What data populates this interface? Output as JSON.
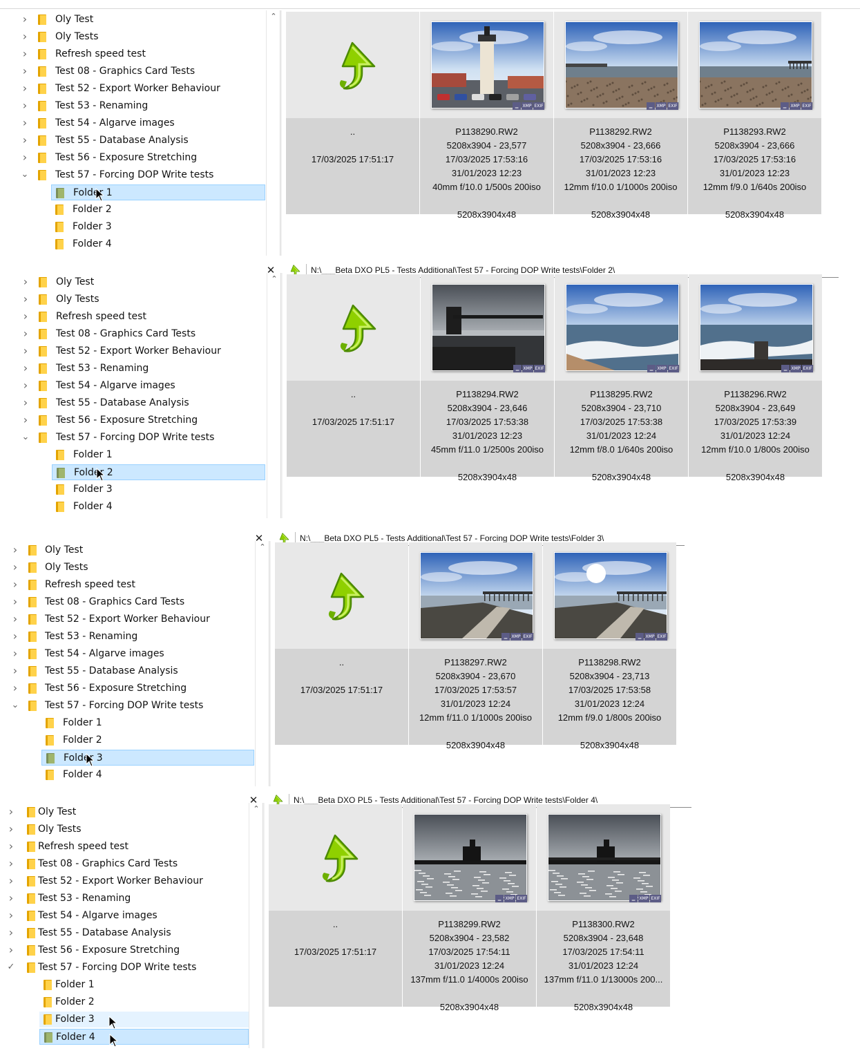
{
  "tree_items": [
    "Oly Test",
    "Oly Tests",
    "Refresh speed test",
    "Test 08 - Graphics Card Tests",
    "Test 52 - Export Worker Behaviour",
    "Test 53 - Renaming",
    "Test 54 - Algarve images",
    "Test 55 - Database Analysis",
    "Test 56 - Exposure Stretching",
    "Test 57 - Forcing DOP Write tests"
  ],
  "sub_items": [
    "Folder 1",
    "Folder 2",
    "Folder 3",
    "Folder 4"
  ],
  "parent_dir": {
    "label": "..",
    "date": "17/03/2025 17:51:17"
  },
  "badges": [
    "▁",
    "XMP",
    "EXIF"
  ],
  "panels": [
    {
      "path": "",
      "selected": 0,
      "files": [
        {
          "name": "P1138290.RW2",
          "dims": "5208x3904 - 23,577",
          "modified": "17/03/2025 17:53:16",
          "taken": "31/01/2023 12:23",
          "exposure": "40mm f/10.0 1/500s 200iso",
          "res": "5208x3904x48",
          "scene": "lighthouse"
        },
        {
          "name": "P1138292.RW2",
          "dims": "5208x3904 - 23,666",
          "modified": "17/03/2025 17:53:16",
          "taken": "31/01/2023 12:23",
          "exposure": "12mm f/10.0 1/1000s 200iso",
          "res": "5208x3904x48",
          "scene": "beach-sun"
        },
        {
          "name": "P1138293.RW2",
          "dims": "5208x3904 - 23,666",
          "modified": "17/03/2025 17:53:16",
          "taken": "31/01/2023 12:23",
          "exposure": "12mm f/9.0 1/640s 200iso",
          "res": "5208x3904x48",
          "scene": "beach-pier"
        }
      ]
    },
    {
      "path": "N:\\___Beta DXO PL5 - Tests Additional\\Test 57 - Forcing DOP Write tests\\Folder 2\\",
      "selected": 1,
      "files": [
        {
          "name": "P1138294.RW2",
          "dims": "5208x3904 - 23,646",
          "modified": "17/03/2025 17:53:38",
          "taken": "31/01/2023 12:23",
          "exposure": "45mm f/11.0 1/2500s 200iso",
          "res": "5208x3904x48",
          "scene": "harbour-dark"
        },
        {
          "name": "P1138295.RW2",
          "dims": "5208x3904 - 23,710",
          "modified": "17/03/2025 17:53:38",
          "taken": "31/01/2023 12:24",
          "exposure": "12mm f/8.0 1/640s 200iso",
          "res": "5208x3904x48",
          "scene": "beach-waves"
        },
        {
          "name": "P1138296.RW2",
          "dims": "5208x3904 - 23,649",
          "modified": "17/03/2025 17:53:39",
          "taken": "31/01/2023 12:24",
          "exposure": "12mm f/10.0 1/800s 200iso",
          "res": "5208x3904x48",
          "scene": "waves-post"
        }
      ]
    },
    {
      "path": "N:\\___Beta DXO PL5 - Tests Additional\\Test 57 - Forcing DOP Write tests\\Folder 3\\",
      "selected": 2,
      "files": [
        {
          "name": "P1138297.RW2",
          "dims": "5208x3904 - 23,670",
          "modified": "17/03/2025 17:53:57",
          "taken": "31/01/2023 12:24",
          "exposure": "12mm f/11.0 1/1000s 200iso",
          "res": "5208x3904x48",
          "scene": "slipway"
        },
        {
          "name": "P1138298.RW2",
          "dims": "5208x3904 - 23,713",
          "modified": "17/03/2025 17:53:58",
          "taken": "31/01/2023 12:24",
          "exposure": "12mm f/9.0 1/800s 200iso",
          "res": "5208x3904x48",
          "scene": "slipway-sun"
        }
      ]
    },
    {
      "path": "N:\\___Beta DXO PL5 - Tests Additional\\Test 57 - Forcing DOP Write tests\\Folder 4\\",
      "selected": 3,
      "files": [
        {
          "name": "P1138299.RW2",
          "dims": "5208x3904 - 23,582",
          "modified": "17/03/2025 17:54:11",
          "taken": "31/01/2023 12:24",
          "exposure": "137mm f/11.0 1/4000s 200iso",
          "res": "5208x3904x48",
          "scene": "silhouette"
        },
        {
          "name": "P1138300.RW2",
          "dims": "5208x3904 - 23,648",
          "modified": "17/03/2025 17:54:11",
          "taken": "31/01/2023 12:24",
          "exposure": "137mm f/11.0 1/13000s 200...",
          "res": "5208x3904x48",
          "scene": "silhouette-2"
        }
      ]
    }
  ],
  "icons": {
    "restore": "restore-window-icon",
    "close": "close-icon",
    "up": "parent-folder-icon",
    "expand": "chevron-right-icon",
    "collapse": "chevron-down-icon",
    "folder": "folder-icon"
  },
  "colors": {
    "selection": "#cce8ff",
    "cell": "#d4d4d4",
    "arrow": "#8fd000",
    "folder": "#ffd24a"
  }
}
